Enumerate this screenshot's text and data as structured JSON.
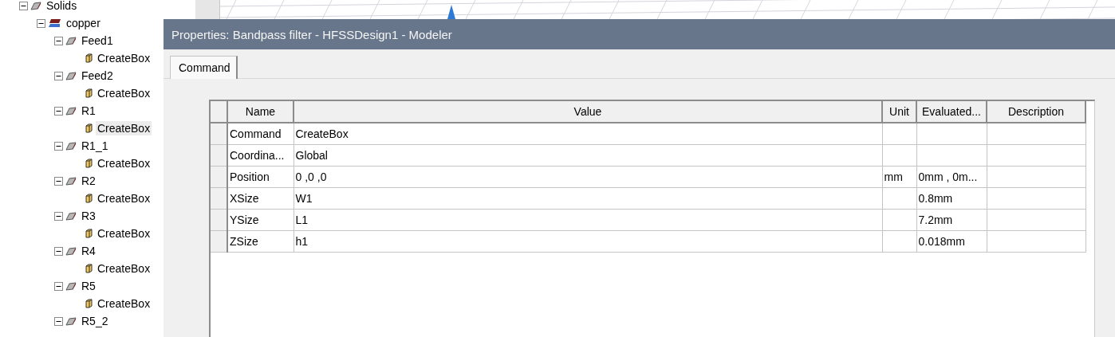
{
  "tree": [
    {
      "label": "Solids",
      "kind": "group",
      "expanded": true,
      "children": [
        {
          "label": "copper",
          "kind": "material",
          "expanded": true,
          "children": [
            {
              "label": "Feed1",
              "kind": "object",
              "expanded": true,
              "children": [
                {
                  "label": "CreateBox",
                  "kind": "command",
                  "selected": false
                }
              ]
            },
            {
              "label": "Feed2",
              "kind": "object",
              "expanded": true,
              "children": [
                {
                  "label": "CreateBox",
                  "kind": "command",
                  "selected": false
                }
              ]
            },
            {
              "label": "R1",
              "kind": "object",
              "expanded": true,
              "children": [
                {
                  "label": "CreateBox",
                  "kind": "command",
                  "selected": true
                }
              ]
            },
            {
              "label": "R1_1",
              "kind": "object",
              "expanded": true,
              "children": [
                {
                  "label": "CreateBox",
                  "kind": "command",
                  "selected": false
                }
              ]
            },
            {
              "label": "R2",
              "kind": "object",
              "expanded": true,
              "children": [
                {
                  "label": "CreateBox",
                  "kind": "command",
                  "selected": false
                }
              ]
            },
            {
              "label": "R3",
              "kind": "object",
              "expanded": true,
              "children": [
                {
                  "label": "CreateBox",
                  "kind": "command",
                  "selected": false
                }
              ]
            },
            {
              "label": "R4",
              "kind": "object",
              "expanded": true,
              "children": [
                {
                  "label": "CreateBox",
                  "kind": "command",
                  "selected": false
                }
              ]
            },
            {
              "label": "R5",
              "kind": "object",
              "expanded": true,
              "children": [
                {
                  "label": "CreateBox",
                  "kind": "command",
                  "selected": false
                }
              ]
            },
            {
              "label": "R5_2",
              "kind": "object",
              "expanded": true
            }
          ]
        }
      ]
    }
  ],
  "dialog": {
    "title": "Properties: Bandpass filter - HFSSDesign1 - Modeler",
    "tabs": [
      {
        "label": "Command",
        "selected": true
      }
    ],
    "table": {
      "columns": [
        "Name",
        "Value",
        "Unit",
        "Evaluated...",
        "Description"
      ],
      "rows": [
        [
          "Command",
          "CreateBox",
          "",
          "",
          ""
        ],
        [
          "Coordina...",
          "Global",
          "",
          "",
          ""
        ],
        [
          "Position",
          "0 ,0 ,0",
          "mm",
          "0mm , 0m...",
          ""
        ],
        [
          "XSize",
          "W1",
          "",
          "0.8mm",
          ""
        ],
        [
          "YSize",
          "L1",
          "",
          "7.2mm",
          ""
        ],
        [
          "ZSize",
          "h1",
          "",
          "0.018mm",
          ""
        ]
      ]
    }
  }
}
